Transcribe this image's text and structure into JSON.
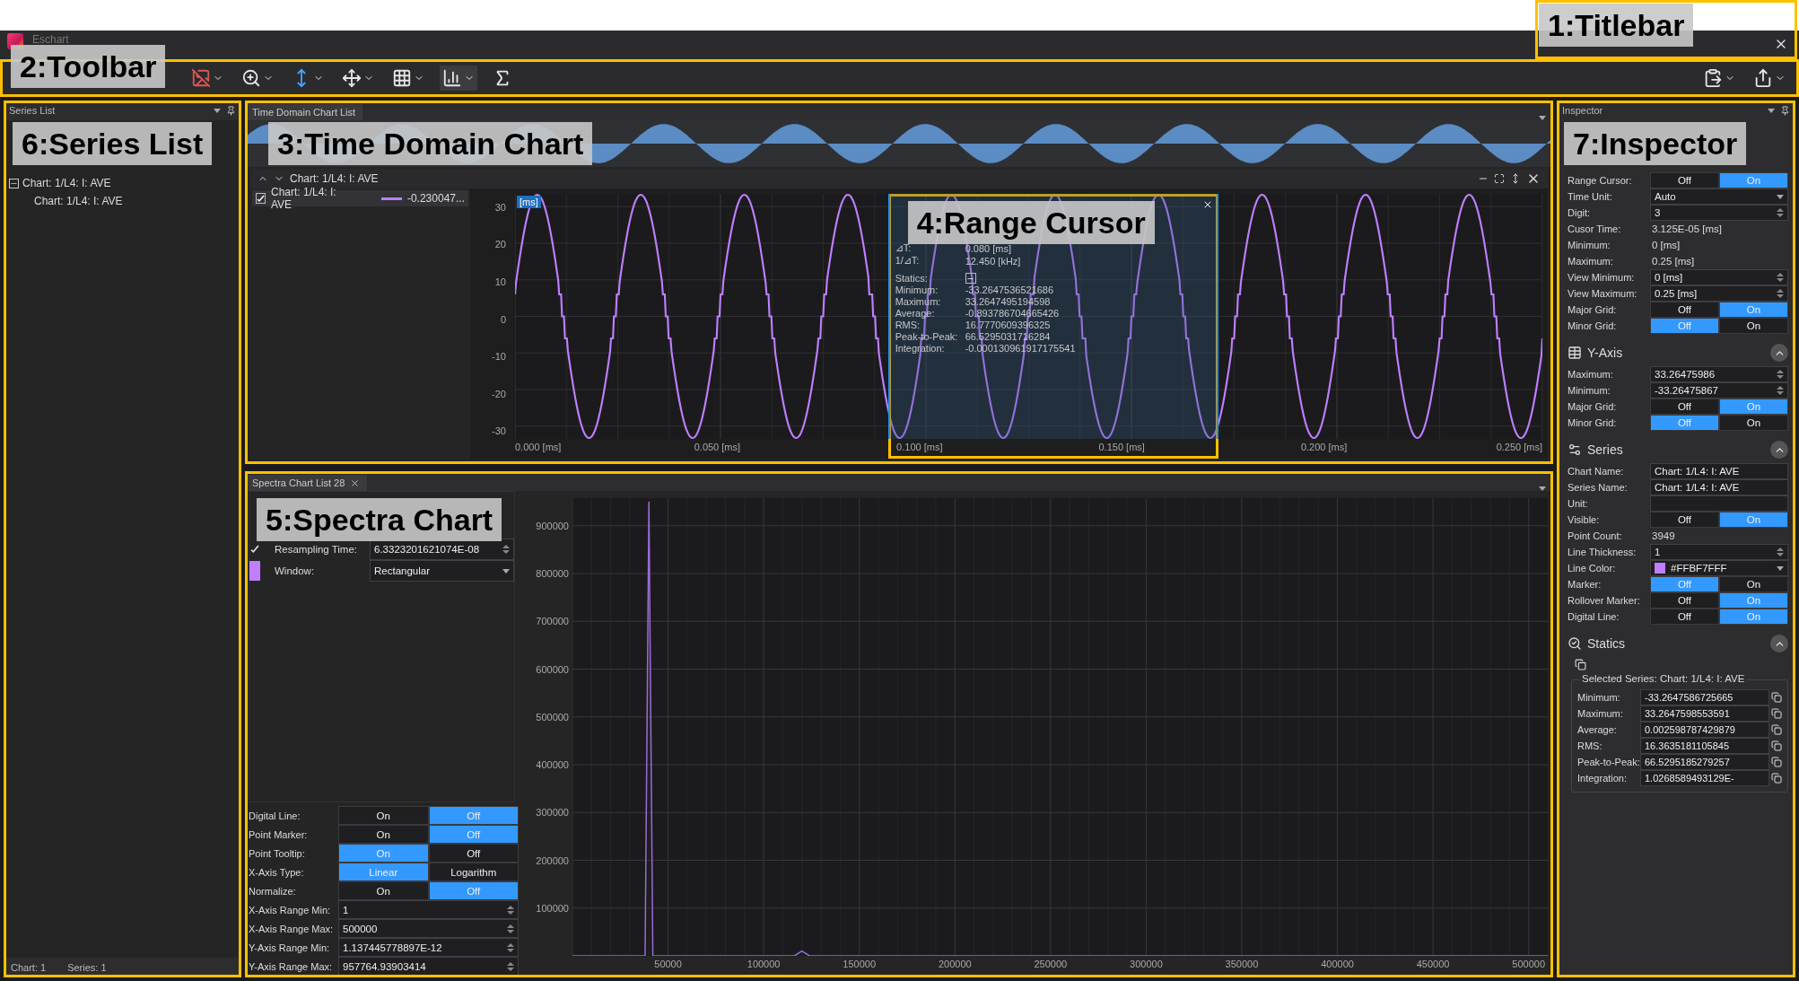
{
  "titlebar": {
    "title": "Eschart",
    "annotation": "1:Titlebar"
  },
  "toolbar": {
    "annotation": "2:Toolbar"
  },
  "series_list": {
    "title": "Series List",
    "annotation": "6:Series List",
    "tree": [
      {
        "label": "Chart: 1/L4: I: AVE",
        "expanded": true,
        "children": [
          {
            "label": "Chart: 1/L4: I: AVE"
          }
        ]
      }
    ],
    "status": [
      "Chart: 1",
      "Series: 1"
    ]
  },
  "time_chart": {
    "tab": "Time Domain Chart List",
    "annotation": "3:Time Domain Chart",
    "header": "Chart: 1/L4: I: AVE",
    "legend": [
      {
        "label": "Chart: 1/L4: I: AVE",
        "checked": true,
        "value": "-0.230047..."
      }
    ],
    "unit_badge": "[ms]",
    "y_ticks": [
      "30",
      "20",
      "10",
      "0",
      "-10",
      "-20",
      "-30"
    ],
    "x_ticks": [
      "0.000 [ms]",
      "0.050 [ms]",
      "0.100 [ms]",
      "0.150 [ms]",
      "0.200 [ms]",
      "0.250 [ms]"
    ],
    "range_cursor": {
      "annotation": "4:Range Cursor",
      "rows": [
        {
          "label": "⊿T:",
          "value": "0.080 [ms]"
        },
        {
          "label": "1/⊿T:",
          "value": "12.450 [kHz]"
        }
      ],
      "statics_label": "Statics:",
      "statics_expanded": true,
      "stats": [
        {
          "label": "Minimum:",
          "value": "-33.2647536521686"
        },
        {
          "label": "Maximum:",
          "value": "33.2647495194598"
        },
        {
          "label": "Average:",
          "value": "-0.893786704665426"
        },
        {
          "label": "RMS:",
          "value": "16.7770609396325"
        },
        {
          "label": "Peak-to-Peak:",
          "value": "66.5295031716284"
        },
        {
          "label": "Integration:",
          "value": "-0.000130961917175541"
        }
      ]
    }
  },
  "spectra": {
    "tab": "Spectra Chart List 28",
    "annotation": "5:Spectra Chart",
    "rows": [
      {
        "kind": "check",
        "label": "Resampling Time:",
        "checked": true,
        "value": "6.3323201621074E-08"
      },
      {
        "kind": "swatch",
        "label": "Window:",
        "value": "Rectangular"
      }
    ],
    "settings": [
      {
        "kind": "toggle",
        "label": "Digital Line:",
        "options": [
          {
            "label": "On",
            "selected": false
          },
          {
            "label": "Off",
            "selected": true
          }
        ]
      },
      {
        "kind": "toggle",
        "label": "Point Marker:",
        "options": [
          {
            "label": "On",
            "selected": false
          },
          {
            "label": "Off",
            "selected": true
          }
        ]
      },
      {
        "kind": "toggle",
        "label": "Point Tooltip:",
        "options": [
          {
            "label": "On",
            "selected": true
          },
          {
            "label": "Off",
            "selected": false
          }
        ]
      },
      {
        "kind": "toggle",
        "label": "X-Axis Type:",
        "options": [
          {
            "label": "Linear",
            "selected": true
          },
          {
            "label": "Logarithm",
            "selected": false
          }
        ]
      },
      {
        "kind": "toggle",
        "label": "Normalize:",
        "options": [
          {
            "label": "On",
            "selected": false
          },
          {
            "label": "Off",
            "selected": true
          }
        ]
      },
      {
        "kind": "spinner",
        "label": "X-Axis Range Min:",
        "value": "1"
      },
      {
        "kind": "spinner",
        "label": "X-Axis Range Max:",
        "value": "500000"
      },
      {
        "kind": "spinner",
        "label": "Y-Axis Range Min:",
        "value": "1.137445778897E-12"
      },
      {
        "kind": "spinner",
        "label": "Y-Axis Range Max:",
        "value": "957764.93903414"
      }
    ],
    "chart_data": {
      "type": "line",
      "x": [
        0,
        38000,
        40000,
        42000,
        116000,
        120000,
        124000,
        196000,
        200000,
        204000,
        280000,
        360000,
        510000
      ],
      "series": [
        {
          "color": "#9a6cd6",
          "values": [
            0,
            0,
            950000,
            0,
            0,
            10000,
            0,
            0,
            0,
            0,
            0,
            0,
            0
          ]
        }
      ],
      "grid": true,
      "xlim": [
        0,
        510000
      ],
      "ylim": [
        0,
        957764.93903414
      ],
      "xticks": [
        50000,
        100000,
        150000,
        200000,
        250000,
        300000,
        350000,
        400000,
        450000,
        500000
      ],
      "yticks": [
        100000,
        200000,
        300000,
        400000,
        500000,
        600000,
        700000,
        800000,
        900000
      ]
    }
  },
  "inspector": {
    "title": "Inspector",
    "annotation": "7:Inspector",
    "sections": [
      {
        "kind": "axis",
        "rows": [
          {
            "kind": "toggle",
            "label": "Range Cursor:",
            "options": [
              {
                "label": "Off",
                "selected": false
              },
              {
                "label": "On",
                "selected": true
              }
            ]
          },
          {
            "kind": "dropdown",
            "label": "Time Unit:",
            "value": "Auto"
          },
          {
            "kind": "spinner",
            "label": "Digit:",
            "value": "3"
          },
          {
            "kind": "text",
            "label": "Cusor Time:",
            "value": "3.125E-05 [ms]"
          },
          {
            "kind": "text",
            "label": "Minimum:",
            "value": "0 [ms]"
          },
          {
            "kind": "text",
            "label": "Maximum:",
            "value": "0.25 [ms]"
          },
          {
            "kind": "spinner",
            "label": "View Minimum:",
            "value": "0 [ms]"
          },
          {
            "kind": "spinner",
            "label": "View Maximum:",
            "value": "0.25 [ms]"
          },
          {
            "kind": "toggle",
            "label": "Major Grid:",
            "options": [
              {
                "label": "Off",
                "selected": false
              },
              {
                "label": "On",
                "selected": true
              }
            ]
          },
          {
            "kind": "toggle",
            "label": "Minor Grid:",
            "options": [
              {
                "label": "Off",
                "selected": true
              },
              {
                "label": "On",
                "selected": false
              }
            ]
          }
        ]
      },
      {
        "kind": "axis",
        "title": "Y-Axis",
        "expanded": true,
        "rows": [
          {
            "kind": "spinner",
            "label": "Maximum:",
            "value": "33.26475986"
          },
          {
            "kind": "spinner",
            "label": "Minimum:",
            "value": "-33.26475867"
          },
          {
            "kind": "toggle",
            "label": "Major Grid:",
            "options": [
              {
                "label": "Off",
                "selected": false
              },
              {
                "label": "On",
                "selected": true
              }
            ]
          },
          {
            "kind": "toggle",
            "label": "Minor Grid:",
            "options": [
              {
                "label": "Off",
                "selected": true
              },
              {
                "label": "On",
                "selected": false
              }
            ]
          }
        ]
      },
      {
        "kind": "series",
        "title": "Series",
        "expanded": true,
        "rows": [
          {
            "kind": "field",
            "label": "Chart Name:",
            "value": "Chart: 1/L4: I: AVE"
          },
          {
            "kind": "field",
            "label": "Series Name:",
            "value": "Chart: 1/L4: I: AVE"
          },
          {
            "kind": "field",
            "label": "Unit:"
          },
          {
            "kind": "toggle",
            "label": "Visible:",
            "options": [
              {
                "label": "Off",
                "selected": false
              },
              {
                "label": "On",
                "selected": true
              }
            ]
          },
          {
            "kind": "text",
            "label": "Point Count:",
            "value": "3949"
          },
          {
            "kind": "spinner",
            "label": "Line Thickness:",
            "value": "1"
          },
          {
            "kind": "color",
            "label": "Line Color:",
            "value": "#FFBF7FFF",
            "color": "#bf7fff"
          },
          {
            "kind": "toggle",
            "label": "Marker:",
            "options": [
              {
                "label": "Off",
                "selected": true
              },
              {
                "label": "On",
                "selected": false
              }
            ]
          },
          {
            "kind": "toggle",
            "label": "Rollover Marker:",
            "options": [
              {
                "label": "Off",
                "selected": false
              },
              {
                "label": "On",
                "selected": true
              }
            ]
          },
          {
            "kind": "toggle",
            "label": "Digital Line:",
            "options": [
              {
                "label": "Off",
                "selected": false
              },
              {
                "label": "On",
                "selected": true
              }
            ]
          }
        ]
      },
      {
        "kind": "statics",
        "title": "Statics",
        "expanded": true,
        "group_title": "Selected Series: Chart: 1/L4: I: AVE",
        "rows": [
          {
            "label": "Minimum:",
            "value": "-33.2647586725665"
          },
          {
            "label": "Maximum:",
            "value": "33.2647598553591"
          },
          {
            "label": "Average:",
            "value": "0.002598787429879"
          },
          {
            "label": "RMS:",
            "value": "16.3635181105845"
          },
          {
            "label": "Peak-to-Peak:",
            "value": "66.5295185279257"
          },
          {
            "label": "Integration:",
            "value": "1.0268589493129E-"
          }
        ]
      }
    ]
  }
}
